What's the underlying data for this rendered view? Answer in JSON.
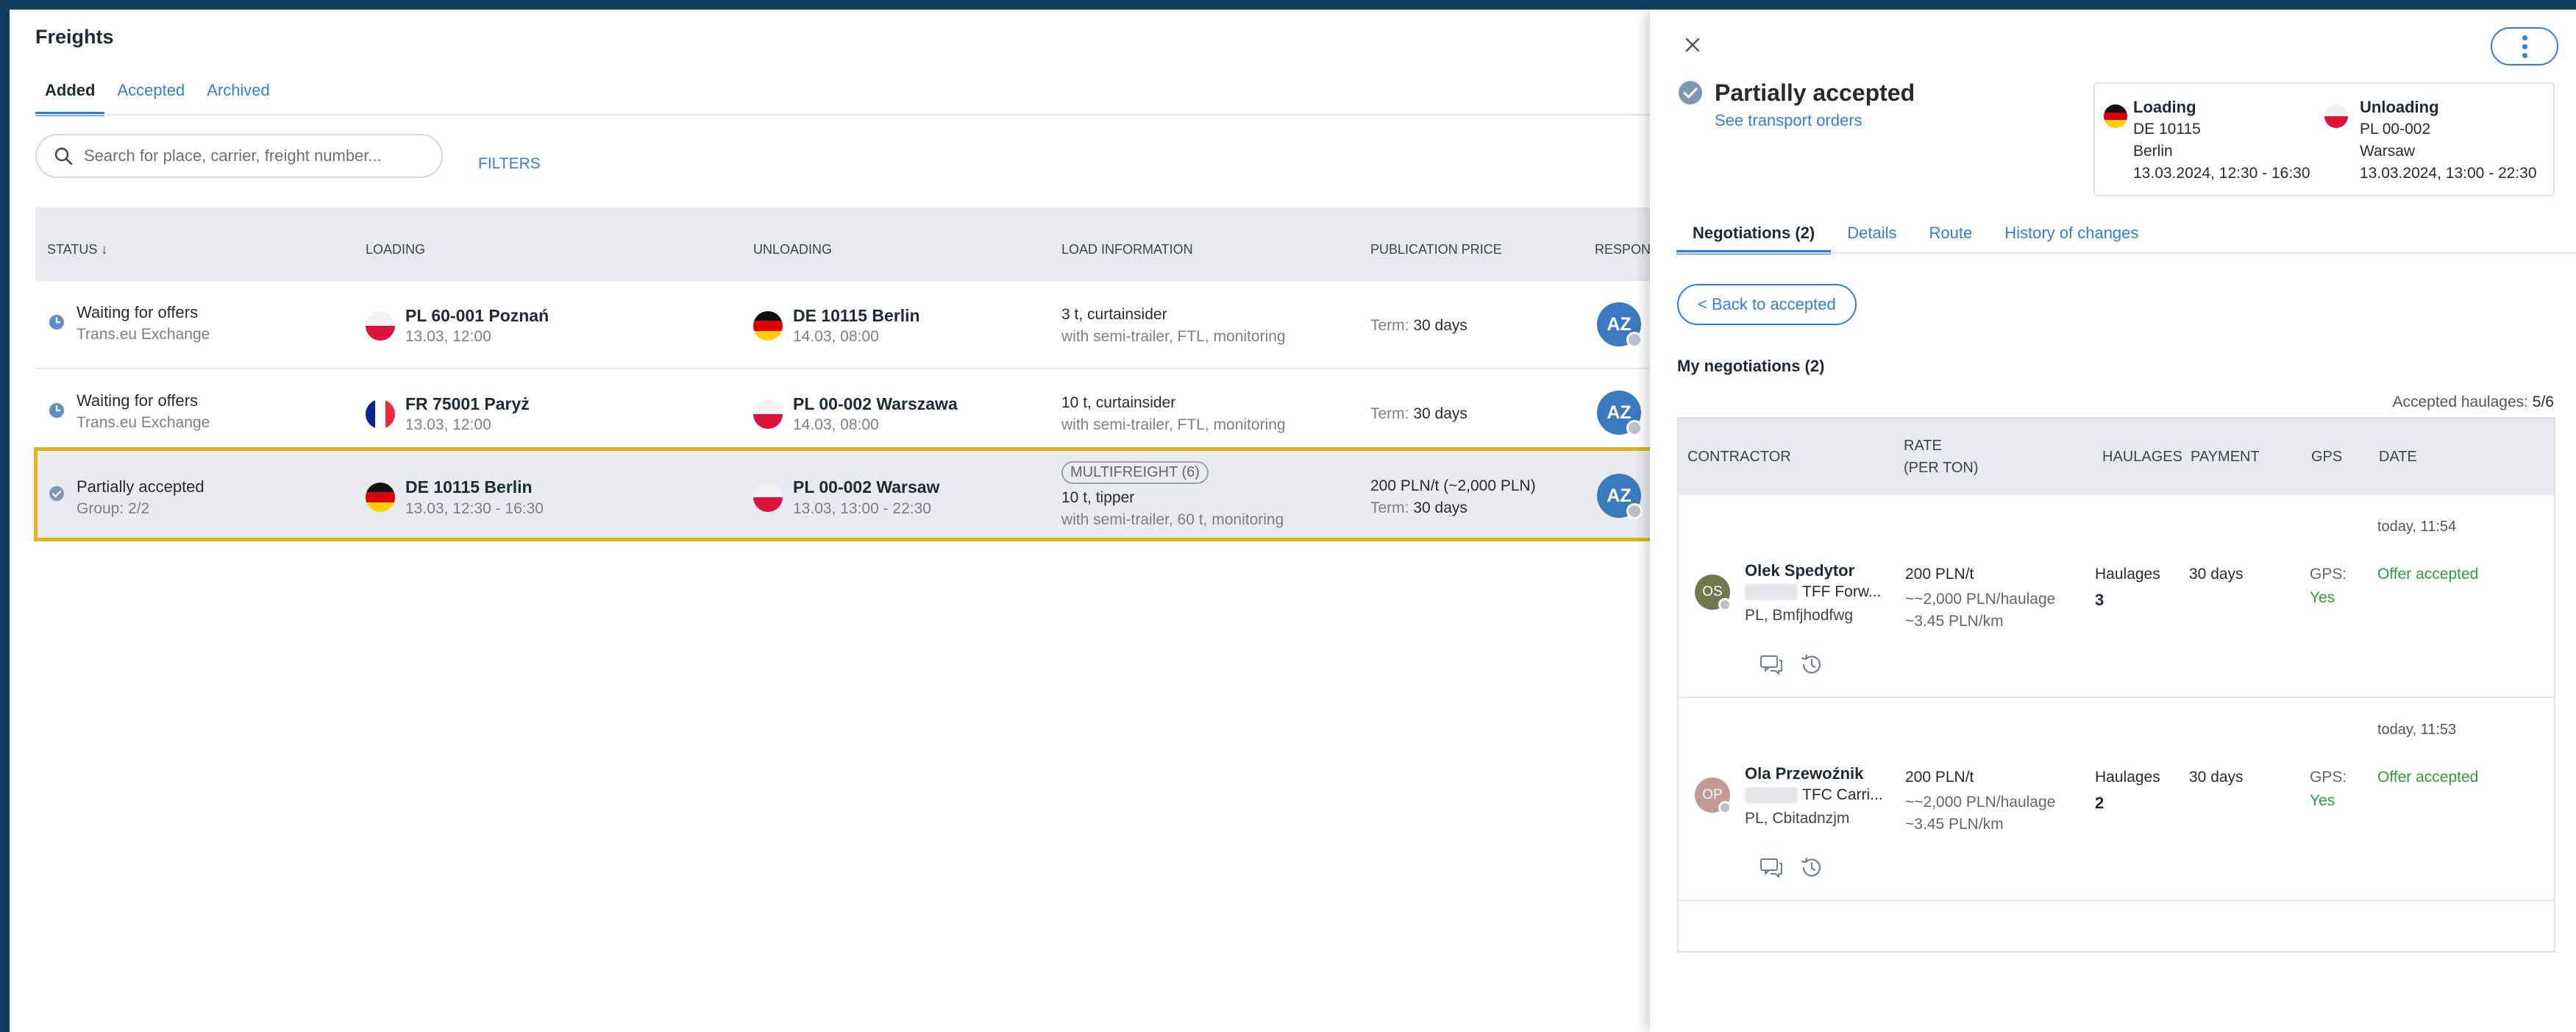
{
  "page": {
    "title": "Freights",
    "tabs": [
      {
        "label": "Added"
      },
      {
        "label": "Accepted"
      },
      {
        "label": "Archived"
      }
    ],
    "search_placeholder": "Search for place, carrier, freight number...",
    "filters_label": "FILTERS"
  },
  "table": {
    "headers": {
      "status": "STATUS ↓",
      "loading": "LOADING",
      "unloading": "UNLOADING",
      "load_info": "LOAD INFORMATION",
      "price": "PUBLICATION PRICE",
      "responsible": "RESPONSI"
    },
    "rows": [
      {
        "status": "Waiting for offers",
        "status_sub": "Trans.eu Exchange",
        "loading": "PL 60-001 Poznań",
        "loading_sub": "13.03, 12:00",
        "unloading": "DE 10115 Berlin",
        "unloading_sub": "14.03, 08:00",
        "load_main": "3 t, curtainsider",
        "load_sub": "with semi-trailer, FTL, monitoring",
        "term_label": "Term:",
        "term_value": "30 days",
        "avatar": "AZ",
        "avatar_name": "A"
      },
      {
        "status": "Waiting for offers",
        "status_sub": "Trans.eu Exchange",
        "loading": "FR 75001 Paryż",
        "loading_sub": "13.03, 12:00",
        "unloading": "PL 00-002 Warszawa",
        "unloading_sub": "14.03, 08:00",
        "load_main": "10 t, curtainsider",
        "load_sub": "with semi-trailer, FTL, monitoring",
        "term_label": "Term:",
        "term_value": "30 days",
        "avatar": "AZ",
        "avatar_name": "A"
      },
      {
        "status": "Partially accepted",
        "status_sub": "Group: 2/2",
        "loading": "DE 10115 Berlin",
        "loading_sub": "13.03, 12:30 - 16:30",
        "unloading": "PL 00-002 Warsaw",
        "unloading_sub": "13.03, 13:00 - 22:30",
        "badge": "MULTIFREIGHT (6)",
        "load_main": "10 t, tipper",
        "load_sub": "with semi-trailer, 60 t, monitoring",
        "price": "200 PLN/t (~2,000 PLN)",
        "term_label": "Term:",
        "term_value": "30 days",
        "avatar": "AZ",
        "avatar_name": "A"
      }
    ]
  },
  "panel": {
    "title": "Partially accepted",
    "link": "See transport orders",
    "loading": {
      "title": "Loading",
      "code": "DE 10115",
      "city": "Berlin",
      "date": "13.03.2024, 12:30 - 16:30"
    },
    "unloading": {
      "title": "Unloading",
      "code": "PL 00-002",
      "city": "Warsaw",
      "date": "13.03.2024, 13:00 - 22:30"
    },
    "tabs": [
      {
        "label": "Negotiations (2)"
      },
      {
        "label": "Details"
      },
      {
        "label": "Route"
      },
      {
        "label": "History of changes"
      }
    ],
    "back_label": "< Back to accepted",
    "my_negotiations": "My negotiations (2)",
    "accepted_label": "Accepted haulages:",
    "accepted_value": "5/6",
    "neg_headers": {
      "contractor": "CONTRACTOR",
      "rate_1": "RATE",
      "rate_2": "(PER TON)",
      "haulages": "HAULAGES",
      "payment": "PAYMENT",
      "gps": "GPS",
      "date": "DATE"
    },
    "negotiations": [
      {
        "date": "today, 11:54",
        "initials": "OS",
        "avatar_color": "#6f7a4b",
        "name": "Olek Spedytor",
        "company": "TFF Forw...",
        "location": "PL, Bmfjhodfwg",
        "rate": "200 PLN/t",
        "rate_sub1": "~~2,000 PLN/haulage",
        "rate_sub2": "~3.45 PLN/km",
        "haulages_label": "Haulages",
        "haulages_value": "3",
        "payment": "30 days",
        "gps_label": "GPS:",
        "gps_value": "Yes",
        "status": "Offer accepted"
      },
      {
        "date": "today, 11:53",
        "initials": "OP",
        "avatar_color": "#c39a93",
        "name": "Ola Przewoźnik",
        "company": "TFC Carri...",
        "location": "PL, Cbitadnzjm",
        "rate": "200 PLN/t",
        "rate_sub1": "~~2,000 PLN/haulage",
        "rate_sub2": "~3.45 PLN/km",
        "haulages_label": "Haulages",
        "haulages_value": "2",
        "payment": "30 days",
        "gps_label": "GPS:",
        "gps_value": "Yes",
        "status": "Offer accepted"
      }
    ]
  },
  "colors": {
    "accent": "#2f7fd9",
    "selected_border": "#e4b21b",
    "success": "#2e9c3c",
    "frame": "#0c3b5c"
  }
}
